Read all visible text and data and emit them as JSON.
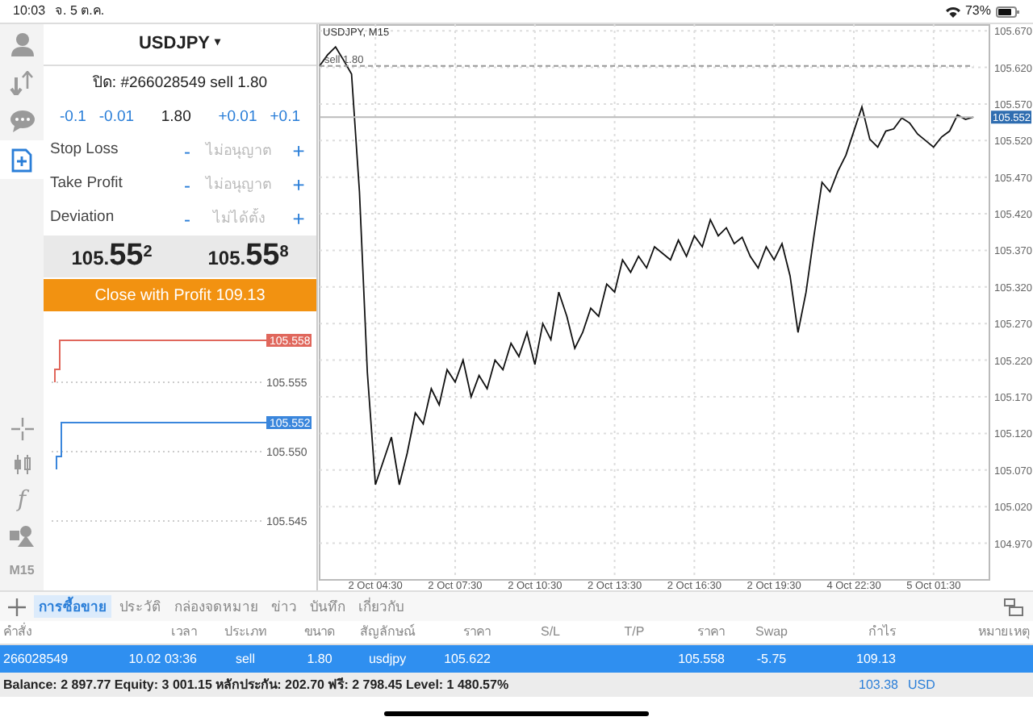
{
  "status_bar": {
    "time": "10:03",
    "date": "จ. 5 ต.ค.",
    "battery": "73%"
  },
  "nav": [
    {
      "kind": "account",
      "selected": false
    },
    {
      "kind": "trade",
      "selected": false
    },
    {
      "kind": "chat",
      "selected": false
    },
    {
      "kind": "new_order",
      "selected": true
    }
  ],
  "tools": [
    {
      "kind": "crosshair"
    },
    {
      "kind": "candles"
    },
    {
      "kind": "glyph",
      "label": "f"
    },
    {
      "kind": "objects"
    },
    {
      "kind": "glyph",
      "label": "M15"
    }
  ],
  "order": {
    "symbol": "USDJPY",
    "caret": "▾",
    "close_label": "ปิด: #266028549 sell 1.80",
    "volume": {
      "decrease": [
        "-0.1",
        "-0.01"
      ],
      "value": "1.80",
      "increase": [
        "+0.01",
        "+0.1"
      ]
    },
    "fields": [
      {
        "label": "Stop Loss",
        "minus": "-",
        "placeholder": "ไม่อนุญาต",
        "plus": "+"
      },
      {
        "label": "Take Profit",
        "minus": "-",
        "placeholder": "ไม่อนุญาต",
        "plus": "+"
      },
      {
        "label": "Deviation",
        "minus": "-",
        "placeholder": "ไม่ได้ตั้ง",
        "plus": "+"
      }
    ],
    "prices": [
      {
        "prefix": "105.",
        "big": "55",
        "sup": "2"
      },
      {
        "prefix": "105.",
        "big": "55",
        "sup": "8"
      }
    ],
    "close_button": "Close with Profit 109.13"
  },
  "tick_chart": {
    "lines": [
      {
        "label": "105.558",
        "color": "#e0675c"
      },
      {
        "label": "105.552",
        "color": "#3a86dc"
      }
    ],
    "yticks": [
      "105.555",
      "105.550",
      "105.545"
    ]
  },
  "chart": {
    "chart_data": {
      "type": "line",
      "title": "USDJPY, M15",
      "categories": [
        null,
        null,
        null,
        null,
        null,
        null,
        null,
        "2 Oct 04:30",
        null,
        null,
        null,
        null,
        null,
        null,
        null,
        null,
        null,
        "2 Oct 07:30",
        null,
        null,
        null,
        null,
        null,
        null,
        null,
        null,
        null,
        "2 Oct 10:30",
        null,
        null,
        null,
        null,
        null,
        null,
        null,
        null,
        null,
        "2 Oct 13:30",
        null,
        null,
        null,
        null,
        null,
        null,
        null,
        null,
        null,
        "2 Oct 16:30",
        null,
        null,
        null,
        null,
        null,
        null,
        null,
        null,
        null,
        "2 Oct 19:30",
        null,
        null,
        null,
        null,
        null,
        null,
        null,
        null,
        null,
        "4 Oct 22:30",
        null,
        null,
        null,
        null,
        null,
        null,
        null,
        null,
        null,
        "5 Oct 01:30",
        null,
        null,
        null,
        null,
        null
      ],
      "series": [
        {
          "color": "#111111",
          "values": [
            105.622,
            105.637,
            105.648,
            105.63,
            105.611,
            105.45,
            105.203,
            105.05,
            105.082,
            105.115,
            105.05,
            105.093,
            105.148,
            105.133,
            105.181,
            105.159,
            105.207,
            105.19,
            105.22,
            105.17,
            105.199,
            105.181,
            105.22,
            105.207,
            105.243,
            105.225,
            105.258,
            105.214,
            105.27,
            105.248,
            105.313,
            105.28,
            105.236,
            105.258,
            105.291,
            105.28,
            105.324,
            105.313,
            105.357,
            105.34,
            105.362,
            105.346,
            105.375,
            105.366,
            105.357,
            105.384,
            105.362,
            105.39,
            105.375,
            105.412,
            105.39,
            105.401,
            105.379,
            105.388,
            105.362,
            105.346,
            105.375,
            105.357,
            105.379,
            105.335,
            105.258,
            105.313,
            105.39,
            105.463,
            105.45,
            105.478,
            105.5,
            105.533,
            105.566,
            105.522,
            105.511,
            105.533,
            105.536,
            105.551,
            105.544,
            105.529,
            105.52,
            105.511,
            105.525,
            105.533,
            105.555,
            105.549,
            105.552
          ]
        },
        {
          "name": "sell 1.80",
          "color": "#999999",
          "line_style": "dashed",
          "values": [
            105.622,
            105.622,
            105.622,
            105.622,
            105.622,
            105.622,
            105.622,
            105.622,
            105.622,
            105.622,
            105.622,
            105.622,
            105.622,
            105.622,
            105.622,
            105.622,
            105.622,
            105.622,
            105.622,
            105.622,
            105.622,
            105.622,
            105.622,
            105.622,
            105.622,
            105.622,
            105.622,
            105.622,
            105.622,
            105.622,
            105.622,
            105.622,
            105.622,
            105.622,
            105.622,
            105.622,
            105.622,
            105.622,
            105.622,
            105.622,
            105.622,
            105.622,
            105.622,
            105.622,
            105.622,
            105.622,
            105.622,
            105.622,
            105.622,
            105.622,
            105.622,
            105.622,
            105.622,
            105.622,
            105.622,
            105.622,
            105.622,
            105.622,
            105.622,
            105.622,
            105.622,
            105.622,
            105.622,
            105.622,
            105.622,
            105.622,
            105.622,
            105.622,
            105.622,
            105.622,
            105.622,
            105.622,
            105.622,
            105.622,
            105.622,
            105.622,
            105.622,
            105.622,
            105.622,
            105.622,
            105.622,
            105.622,
            105.622
          ]
        },
        {
          "name": "105.552",
          "color": "#bbbbbb",
          "values": [
            105.552,
            105.552,
            105.552,
            105.552,
            105.552,
            105.552,
            105.552,
            105.552,
            105.552,
            105.552,
            105.552,
            105.552,
            105.552,
            105.552,
            105.552,
            105.552,
            105.552,
            105.552,
            105.552,
            105.552,
            105.552,
            105.552,
            105.552,
            105.552,
            105.552,
            105.552,
            105.552,
            105.552,
            105.552,
            105.552,
            105.552,
            105.552,
            105.552,
            105.552,
            105.552,
            105.552,
            105.552,
            105.552,
            105.552,
            105.552,
            105.552,
            105.552,
            105.552,
            105.552,
            105.552,
            105.552,
            105.552,
            105.552,
            105.552,
            105.552,
            105.552,
            105.552,
            105.552,
            105.552,
            105.552,
            105.552,
            105.552,
            105.552,
            105.552,
            105.552,
            105.552,
            105.552,
            105.552,
            105.552,
            105.552,
            105.552,
            105.552,
            105.552,
            105.552,
            105.552,
            105.552,
            105.552,
            105.552,
            105.552,
            105.552,
            105.552,
            105.552,
            105.552,
            105.552,
            105.552,
            105.552,
            105.552,
            105.552
          ]
        }
      ],
      "ylim": [
        104.921,
        105.679
      ],
      "yticks": [
        {
          "value": 105.67,
          "label": "105.670"
        },
        {
          "value": 105.62,
          "label": "105.620"
        },
        {
          "value": 105.57,
          "label": "105.570"
        },
        {
          "value": 105.52,
          "label": "105.520"
        },
        {
          "value": 105.47,
          "label": "105.470"
        },
        {
          "value": 105.42,
          "label": "105.420"
        },
        {
          "value": 105.37,
          "label": "105.370"
        },
        {
          "value": 105.32,
          "label": "105.320"
        },
        {
          "value": 105.27,
          "label": "105.270"
        },
        {
          "value": 105.22,
          "label": "105.220"
        },
        {
          "value": 105.17,
          "label": "105.170"
        },
        {
          "value": 105.12,
          "label": "105.120"
        },
        {
          "value": 105.07,
          "label": "105.070"
        },
        {
          "value": 105.02,
          "label": "105.020"
        },
        {
          "value": 104.97,
          "label": "104.970"
        }
      ],
      "grid": true
    }
  },
  "tabs": [
    {
      "label": "การซื้อขาย",
      "selected": true
    },
    {
      "label": "ประวัติ",
      "selected": false
    },
    {
      "label": "กล่องจดหมาย",
      "selected": false
    },
    {
      "label": "ข่าว",
      "selected": false
    },
    {
      "label": "บันทึก",
      "selected": false
    },
    {
      "label": "เกี่ยวกับ",
      "selected": false
    }
  ],
  "table": {
    "columns": [
      "คำสั่ง",
      "เวลา",
      "ประเภท",
      "ขนาด",
      "สัญลักษณ์",
      "ราคา",
      "S/L",
      "T/P",
      "ราคา",
      "Swap",
      "กำไร",
      "หมายเหตุ"
    ],
    "rows": [
      {
        "selected": true,
        "cells": [
          "266028549",
          "10.02 03:36",
          "sell",
          "1.80",
          "usdjpy",
          "105.622",
          "",
          "",
          "105.558",
          "-5.75",
          "109.13",
          ""
        ]
      }
    ]
  },
  "summary": {
    "text": "Balance: 2 897.77 Equity: 3 001.15 หลักประกัน: 202.70 ฟรี: 2 798.45 Level: 1 480.57%",
    "profit": "103.38",
    "currency": "USD"
  }
}
